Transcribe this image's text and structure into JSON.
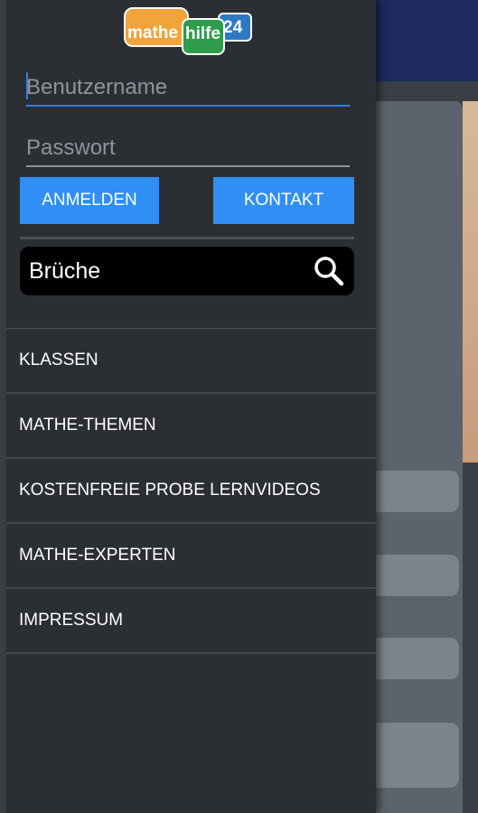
{
  "logo": {
    "part1": "mathe",
    "part2": "hilfe",
    "part3": "24"
  },
  "login": {
    "username_placeholder": "Benutzername",
    "password_placeholder": "Passwort",
    "login_label": "ANMELDEN",
    "contact_label": "KONTAKT"
  },
  "search": {
    "value": "Brüche",
    "icon": "search-icon"
  },
  "menu": {
    "items": [
      {
        "label": "KLASSEN"
      },
      {
        "label": "MATHE-THEMEN"
      },
      {
        "label": "KOSTENFREIE PROBE LERNVIDEOS"
      },
      {
        "label": "MATHE-EXPERTEN"
      },
      {
        "label": "IMPRESSUM"
      }
    ]
  },
  "colors": {
    "accent": "#2f8ff5",
    "drawer": "#2b2f33",
    "topbar": "#1c2a5e"
  }
}
